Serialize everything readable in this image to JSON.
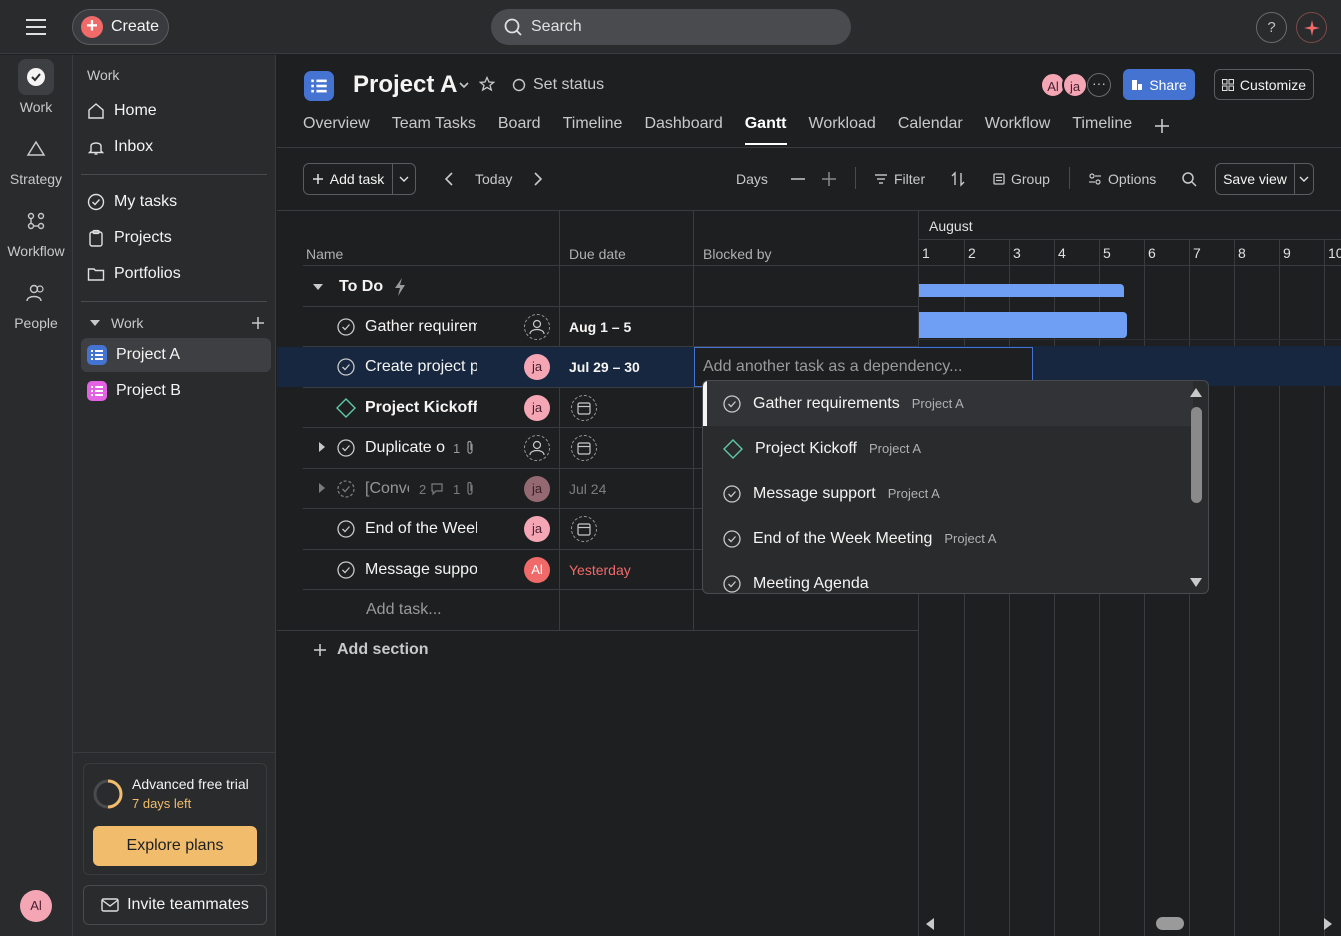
{
  "topbar": {
    "create_label": "Create",
    "search_placeholder": "Search",
    "help_label": "?"
  },
  "rail": {
    "items": [
      {
        "label": "Work"
      },
      {
        "label": "Strategy"
      },
      {
        "label": "Workflow"
      },
      {
        "label": "People"
      }
    ],
    "user_initials": "Al"
  },
  "sidebar": {
    "heading": "Work",
    "nav": [
      {
        "label": "Home"
      },
      {
        "label": "Inbox"
      }
    ],
    "nav2": [
      {
        "label": "My tasks"
      },
      {
        "label": "Projects"
      },
      {
        "label": "Portfolios"
      }
    ],
    "section_label": "Work",
    "projects": [
      {
        "label": "Project A",
        "color": "#4573d2"
      },
      {
        "label": "Project B",
        "color": "#e362e3"
      }
    ],
    "trial": {
      "title": "Advanced free trial",
      "days_left": "7 days left",
      "explore_label": "Explore plans"
    },
    "invite_label": "Invite teammates"
  },
  "project": {
    "title": "Project A",
    "set_status": "Set status",
    "members": [
      "Al",
      "ja"
    ],
    "share_label": "Share",
    "customize_label": "Customize",
    "tabs": [
      "Overview",
      "Team Tasks",
      "Board",
      "Timeline",
      "Dashboard",
      "Gantt",
      "Workload",
      "Calendar",
      "Workflow",
      "Timeline"
    ],
    "active_tab": "Gantt"
  },
  "toolbar": {
    "add_task": "Add task",
    "today": "Today",
    "days": "Days",
    "filter": "Filter",
    "group": "Group",
    "options": "Options",
    "save_view": "Save view"
  },
  "table": {
    "col_name": "Name",
    "col_due": "Due date",
    "col_blocked": "Blocked by",
    "section": "To Do",
    "rows": [
      {
        "name": "Gather requirem",
        "due": "Aug 1 – 5",
        "assignee": ""
      },
      {
        "name": "Create project p",
        "due": "Jul 29 – 30",
        "assignee": "ja"
      },
      {
        "name": "Project Kickoff",
        "due": "",
        "assignee": "ja"
      },
      {
        "name": "Duplicate o",
        "due": "",
        "assignee": "",
        "attach": "1"
      },
      {
        "name": "[Conve",
        "due": "Jul 24",
        "assignee": "ja",
        "comments": "2",
        "attach": "1"
      },
      {
        "name": "End of the Week",
        "due": "",
        "assignee": "ja"
      },
      {
        "name": "Message suppor",
        "due": "Yesterday",
        "assignee": "Al"
      }
    ],
    "add_task_placeholder": "Add task...",
    "add_section": "Add section",
    "dependency_placeholder": "Add another task as a dependency..."
  },
  "gantt": {
    "month": "August",
    "days": [
      "1",
      "2",
      "3",
      "4",
      "5",
      "6",
      "7",
      "8",
      "9",
      "10"
    ],
    "bar_color": "#6f9ff5"
  },
  "dropdown": {
    "items": [
      {
        "name": "Gather requirements",
        "project": "Project A",
        "type": "task"
      },
      {
        "name": "Project Kickoff",
        "project": "Project A",
        "type": "milestone"
      },
      {
        "name": "Message support",
        "project": "Project A",
        "type": "task"
      },
      {
        "name": "End of the Week Meeting",
        "project": "Project A",
        "type": "task"
      },
      {
        "name": "Meeting Agenda",
        "project": "",
        "type": "task"
      }
    ]
  }
}
